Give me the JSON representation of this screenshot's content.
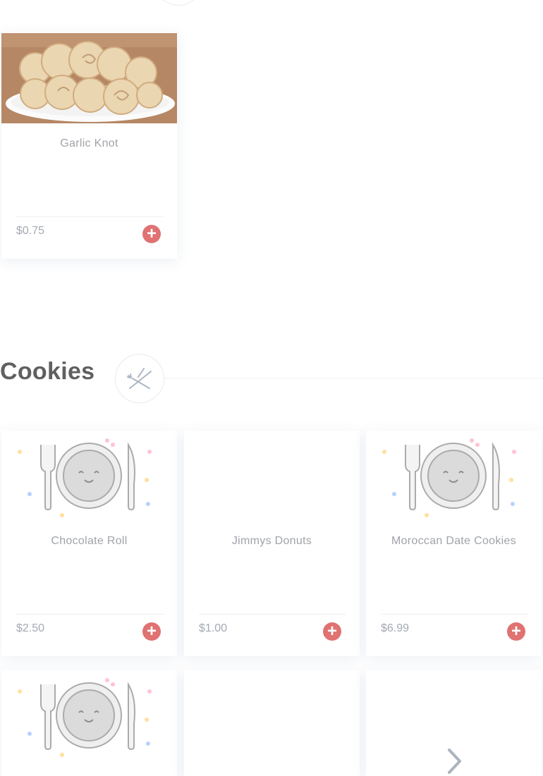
{
  "sections": [
    {
      "items": [
        {
          "name": "Garlic Knot",
          "price": "$0.75",
          "image": "garlic-knot-photo"
        }
      ]
    },
    {
      "title": "Cookies",
      "icon": "fork-knife-icon",
      "items": [
        {
          "name": "Chocolate Roll",
          "price": "$2.50",
          "image": "plate-placeholder"
        },
        {
          "name": "Jimmys Donuts",
          "price": "$1.00",
          "image": ""
        },
        {
          "name": "Moroccan Date Cookies",
          "price": "$6.99",
          "image": "plate-placeholder"
        },
        {
          "name": "",
          "price": "",
          "image": "plate-placeholder"
        },
        {
          "name": "",
          "price": "",
          "image": ""
        },
        {
          "name": "",
          "price": "",
          "image": ""
        }
      ]
    }
  ],
  "add_button_symbol": "+",
  "colors": {
    "accent": "#d84a4a",
    "title": "#3d3d3d",
    "text": "#8c8f95"
  }
}
